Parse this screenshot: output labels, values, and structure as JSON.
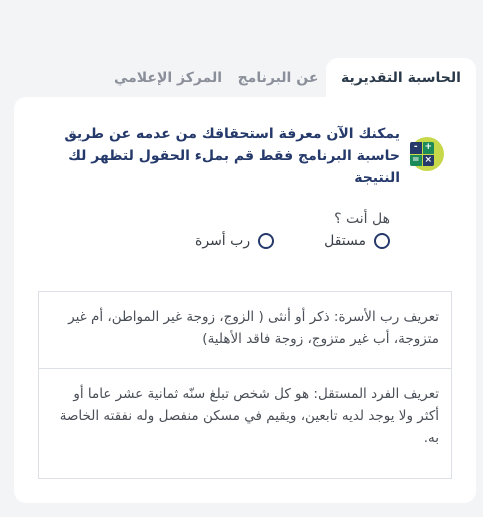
{
  "tabs": [
    {
      "label": "الحاسبة التقديرية",
      "active": true
    },
    {
      "label": "عن البرنامج",
      "active": false
    },
    {
      "label": "المركز الإعلامي",
      "active": false
    }
  ],
  "intro": {
    "text": "يمكنك الآن معرفة استحقاقك من عدمه عن طريق حاسبة البرنامج فقط قم بملء الحقول لتظهر لك النتيجة",
    "icon": "calculator-icon",
    "icon_symbols": [
      "+",
      "-",
      "×",
      "="
    ]
  },
  "question": {
    "label": "هل أنت ؟",
    "options": [
      {
        "label": "مستقل",
        "selected": false
      },
      {
        "label": "رب أسرة",
        "selected": false
      }
    ]
  },
  "definitions": {
    "household_head": "تعريف رب الأسرة: ذكر أو أنثى ( الزوج، زوجة غير المواطن، أم غير متزوجة، أب غير متزوج، زوجة فاقد الأهلية)",
    "independent": "تعريف الفرد المستقل: هو كل شخص تبلغ سنّه ثمانية عشر عاما أو أكثر ولا يوجد لديه تابعين، ويقيم في مسكن منفصل وله نفقته الخاصة به."
  },
  "colors": {
    "accent": "#c7d84a",
    "title": "#253a6b",
    "icon_cells": [
      "#1d8a5a",
      "#253a6b",
      "#253a6b",
      "#1d8a5a"
    ]
  }
}
